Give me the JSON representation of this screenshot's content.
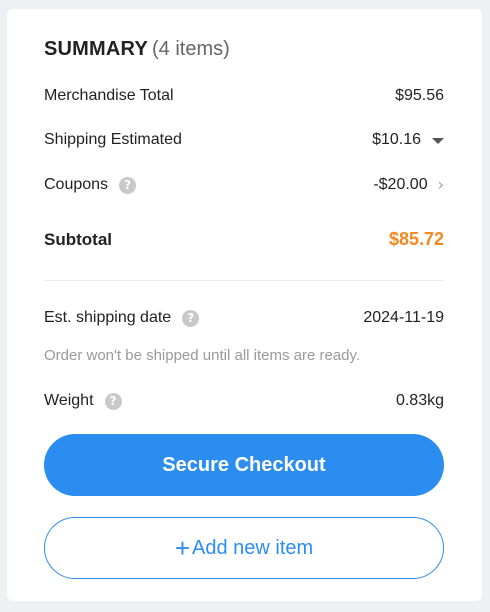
{
  "summary": {
    "title": "SUMMARY",
    "count": "(4 items)"
  },
  "rows": {
    "merchandise": {
      "label": "Merchandise Total",
      "value": "$95.56"
    },
    "shipping": {
      "label": "Shipping Estimated",
      "value": "$10.16",
      "icon": "caret-down-icon"
    },
    "coupons": {
      "label": "Coupons",
      "value": "-$20.00",
      "icon": "chevron-right-icon",
      "help_icon": "?"
    },
    "subtotal": {
      "label": "Subtotal",
      "value": "$85.72",
      "value_color": "#f7871f"
    },
    "ship_date": {
      "label": "Est. shipping date",
      "value": "2024-11-19",
      "help_icon": "?"
    },
    "ship_note": "Order won't be shipped until all items are ready.",
    "weight": {
      "label": "Weight",
      "value": "0.83kg",
      "help_icon": "?"
    }
  },
  "buttons": {
    "checkout": "Secure Checkout",
    "add_plus": "+",
    "add_label": "Add new item"
  },
  "colors": {
    "accent": "#2b8def",
    "price_highlight": "#f7871f",
    "muted_text": "#9a9a9a"
  }
}
